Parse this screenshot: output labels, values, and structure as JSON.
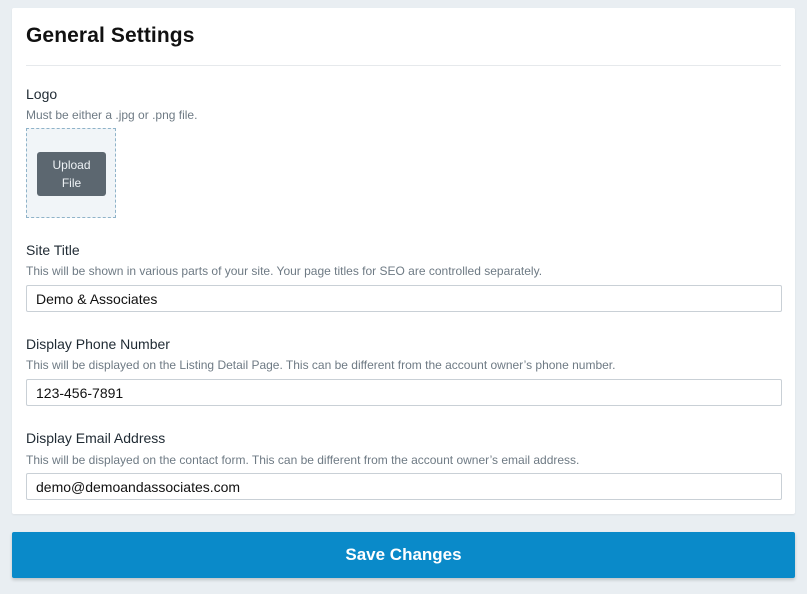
{
  "page": {
    "title": "General Settings"
  },
  "logo": {
    "label": "Logo",
    "help": "Must be either a .jpg or .png file.",
    "upload_label": "Upload\nFile"
  },
  "site_title": {
    "label": "Site Title",
    "help": "This will be shown in various parts of your site. Your page titles for SEO are controlled separately.",
    "value": "Demo & Associates"
  },
  "phone": {
    "label": "Display Phone Number",
    "help": "This will be displayed on the Listing Detail Page. This can be different from the account owner’s phone number.",
    "value": "123-456-7891"
  },
  "email": {
    "label": "Display Email Address",
    "help": "This will be displayed on the contact form. This can be different from the account owner’s email address.",
    "value": "demo@demoandassociates.com"
  },
  "actions": {
    "save_label": "Save Changes"
  },
  "colors": {
    "primary": "#0a8ac9",
    "upload_button": "#5c6770",
    "background": "#e9eef2"
  }
}
